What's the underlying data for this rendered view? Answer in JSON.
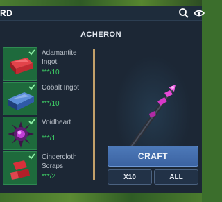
{
  "header": {
    "title": "RD"
  },
  "recipe": {
    "title": "ACHERON"
  },
  "ingredients": [
    {
      "name": "Adamantite Ingot",
      "count": "***/10",
      "icon": "adamantite-ingot-icon"
    },
    {
      "name": "Cobalt Ingot",
      "count": "***/10",
      "icon": "cobalt-ingot-icon"
    },
    {
      "name": "Voidheart",
      "count": "***/1",
      "icon": "voidheart-icon"
    },
    {
      "name": "Cindercloth Scraps",
      "count": "***/2",
      "icon": "cindercloth-scraps-icon"
    }
  ],
  "actions": {
    "craft": "CRAFT",
    "x10": "X10",
    "all": "ALL"
  },
  "colors": {
    "panel_bg": "#1c2735",
    "slot_bg": "#1e6a3c",
    "count_green": "#3fd267",
    "craft_blue": "#4d79b8"
  }
}
